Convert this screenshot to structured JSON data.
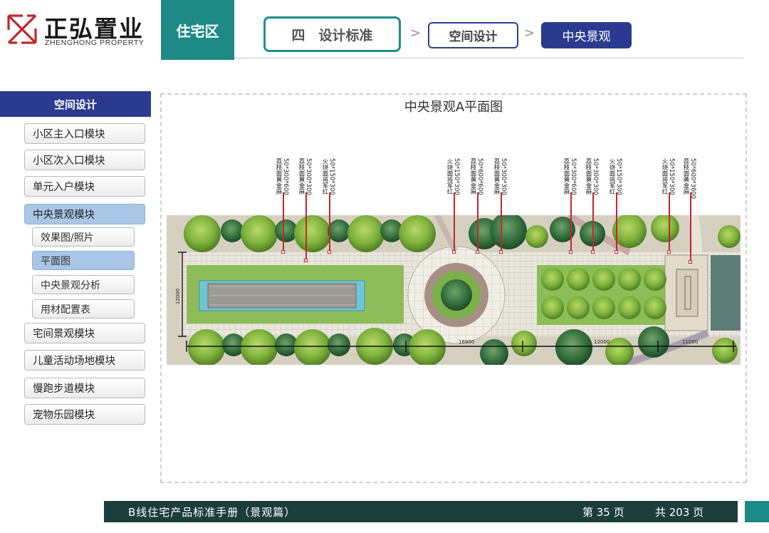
{
  "brand": {
    "name_cn": "正弘置业",
    "name_en": "ZHENGHONG PROPERTY",
    "logo_color": "#c0282e"
  },
  "header": {
    "section": "住宅区",
    "chapter": "四　设计标准",
    "breadcrumb_mid": "空间设计",
    "breadcrumb_current": "中央景观",
    "accent_teal": "#1d8a86",
    "accent_navy": "#2a3b8f"
  },
  "sidebar": {
    "heading": "空间设计",
    "items": [
      {
        "label": "小区主入口模块"
      },
      {
        "label": "小区次入口模块"
      },
      {
        "label": "单元入户模块"
      },
      {
        "label": "中央景观模块",
        "active": true,
        "subitems": [
          {
            "label": "效果图/照片"
          },
          {
            "label": "平面图",
            "active": true
          },
          {
            "label": "中央景观分析"
          },
          {
            "label": "用材配置表"
          }
        ]
      },
      {
        "label": "宅间景观模块"
      },
      {
        "label": "儿童活动场地模块"
      },
      {
        "label": "慢跑步道模块"
      },
      {
        "label": "宠物乐园模块"
      }
    ]
  },
  "plan": {
    "title": "中央景观A平面图",
    "dimensions": [
      "12000",
      "16900",
      "12000",
      "11000"
    ],
    "notes": [
      [
        "50*300*600",
        "荔枝面黄金麻"
      ],
      [
        "50*300*300",
        "荔枝面黄金麻"
      ],
      [
        "50*150*300",
        "火烧面将军红"
      ],
      [
        "50*150*300",
        "火烧面将军红"
      ],
      [
        "50*600*600",
        "荔枝面黄金麻"
      ],
      [
        "50*300*300",
        "荔枝面黄金麻"
      ],
      [
        "50*300*600",
        "荔枝面黄金麻"
      ],
      [
        "50*300*300",
        "荔枝面黄金麻"
      ],
      [
        "50*150*300",
        "火烧面将军红"
      ],
      [
        "50*150*300",
        "火烧面将军红"
      ],
      [
        "50*600*3600",
        "荔枝面黄金麻"
      ]
    ]
  },
  "footer": {
    "title": "B线住宅产品标准手册（景观篇）",
    "page": "第 35 页",
    "total": "共 203 页"
  }
}
